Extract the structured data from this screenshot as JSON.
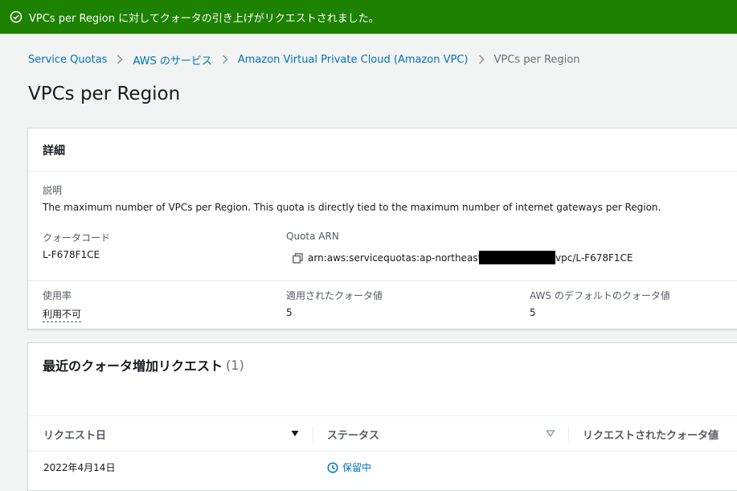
{
  "flash": {
    "message": "VPCs per Region に対してクォータの引き上げがリクエストされました。",
    "color": "#1d8102"
  },
  "breadcrumb": {
    "items": [
      "Service Quotas",
      "AWS のサービス",
      "Amazon Virtual Private Cloud (Amazon VPC)"
    ],
    "current": "VPCs per Region"
  },
  "page": {
    "title": "VPCs per Region"
  },
  "details": {
    "header": "詳細",
    "description_label": "説明",
    "description": "The maximum number of VPCs per Region. This quota is directly tied to the maximum number of internet gateways per Region.",
    "quota_code_label": "クォータコード",
    "quota_code": "L-F678F1CE",
    "quota_arn_label": "Quota ARN",
    "quota_arn_prefix": "arn:aws:servicequotas:ap-northeast-1",
    "quota_arn_suffix": "vpc/L-F678F1CE",
    "utilization_label": "使用率",
    "utilization": "利用不可",
    "applied_label": "適用されたクォータ値",
    "applied_value": "5",
    "default_label": "AWS のデフォルトのクォータ値",
    "default_value": "5"
  },
  "requests": {
    "header": "最近のクォータ増加リクエスト",
    "count": "(1)",
    "columns": [
      "リクエスト日",
      "ステータス",
      "リクエストされたクォータ値"
    ],
    "rows": [
      {
        "date": "2022年4月14日",
        "status": "保留中"
      }
    ]
  }
}
